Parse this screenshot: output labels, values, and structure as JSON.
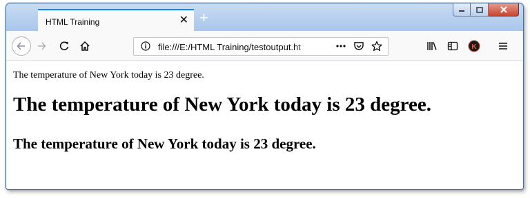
{
  "browser": {
    "tab": {
      "title": "HTML Training",
      "close_icon": "close-icon"
    },
    "new_tab_label": "+",
    "address_bar": {
      "url": "file:///E:/HTML Training/testoutput.ht"
    },
    "toolbar": {
      "profile_initial": "K"
    }
  },
  "page": {
    "paragraph": "The temperature of New York today is 23 degree.",
    "heading1": "The temperature of New York today is 23 degree.",
    "heading2": "The temperature of New York today is 23 degree."
  },
  "colors": {
    "accent": "#0a84ff",
    "titlebar": "#b8d1ef",
    "close_button": "#c7432f"
  }
}
